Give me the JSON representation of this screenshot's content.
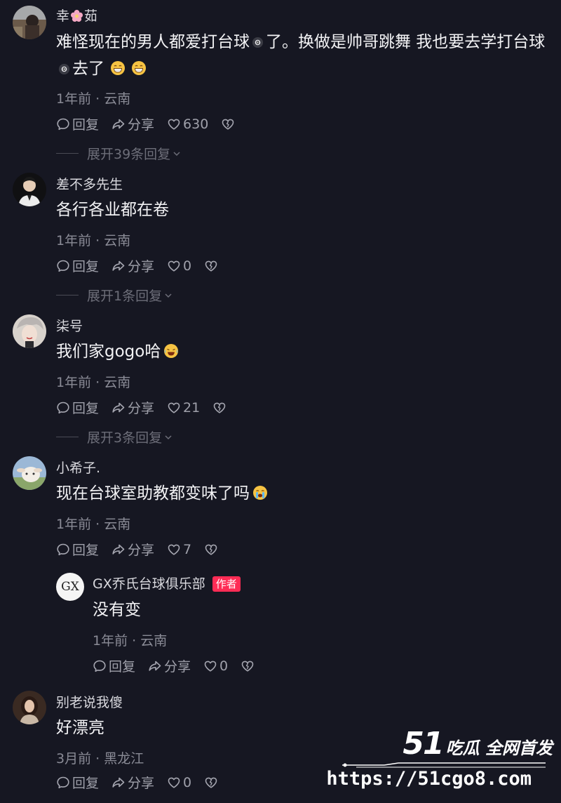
{
  "comments": [
    {
      "username_part1": "幸",
      "username_part2": "茹",
      "text_part1": "难怪现在的男人都爱打台球",
      "text_part2": "了。换做是帅哥跳舞 我也要去学打台球",
      "text_part3": "去了",
      "meta": "1年前 · 云南",
      "reply_label": "回复",
      "share_label": "分享",
      "likes": "630",
      "expand": "展开39条回复"
    },
    {
      "username": "差不多先生",
      "text": "各行各业都在卷",
      "meta": "1年前 · 云南",
      "reply_label": "回复",
      "share_label": "分享",
      "likes": "0",
      "expand": "展开1条回复"
    },
    {
      "username": "柒号",
      "text": "我们家gogo哈",
      "meta": "1年前 · 云南",
      "reply_label": "回复",
      "share_label": "分享",
      "likes": "21",
      "expand": "展开3条回复"
    },
    {
      "username": "小希子.",
      "text": "现在台球室助教都变味了吗",
      "meta": "1年前 · 云南",
      "reply_label": "回复",
      "share_label": "分享",
      "likes": "7",
      "reply": {
        "avatar_text": "GX",
        "username": "GX乔氏台球俱乐部",
        "badge": "作者",
        "text": "没有变",
        "meta": "1年前 · 云南",
        "reply_label": "回复",
        "share_label": "分享",
        "likes": "0"
      }
    },
    {
      "username": "别老说我傻",
      "text": "好漂亮",
      "meta": "3月前 · 黑龙江",
      "reply_label": "回复",
      "share_label": "分享",
      "likes": "0"
    }
  ],
  "watermark": {
    "brand_number": "51",
    "brand_text": "吃瓜 全网首发",
    "url": "https://51cgo8.com"
  },
  "colors": {
    "background": "#161722",
    "author_badge": "#fe2c55",
    "muted_text": "#8a8b96"
  }
}
